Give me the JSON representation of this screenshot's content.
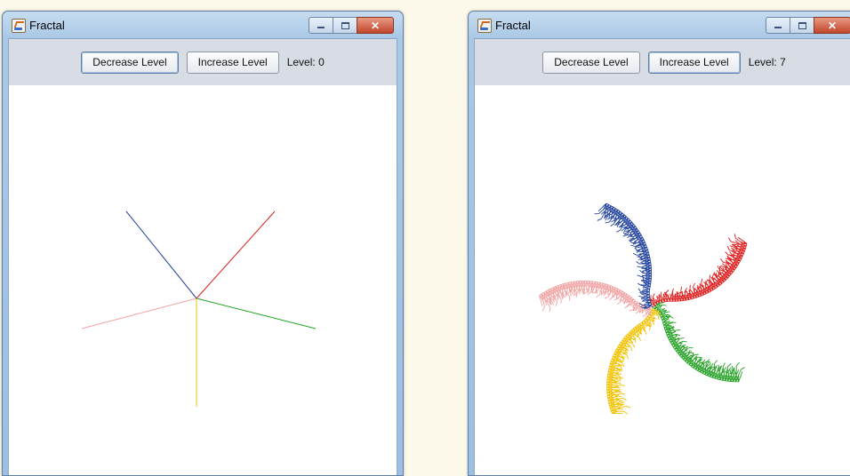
{
  "windows": [
    {
      "title": "Fractal",
      "decrease_label": "Decrease Level",
      "increase_label": "Increase Level",
      "level_label": "Level:",
      "level_value": "0"
    },
    {
      "title": "Fractal",
      "decrease_label": "Decrease Level",
      "increase_label": "Increase Level",
      "level_label": "Level:",
      "level_value": "7"
    }
  ],
  "caption_icons": [
    "minimize-icon",
    "maximize-icon",
    "close-icon"
  ],
  "colors": {
    "red": "#e01e1e",
    "green": "#27a327",
    "yellow": "#f2c200",
    "pink": "#f2a3a3",
    "blue": "#23449e"
  }
}
